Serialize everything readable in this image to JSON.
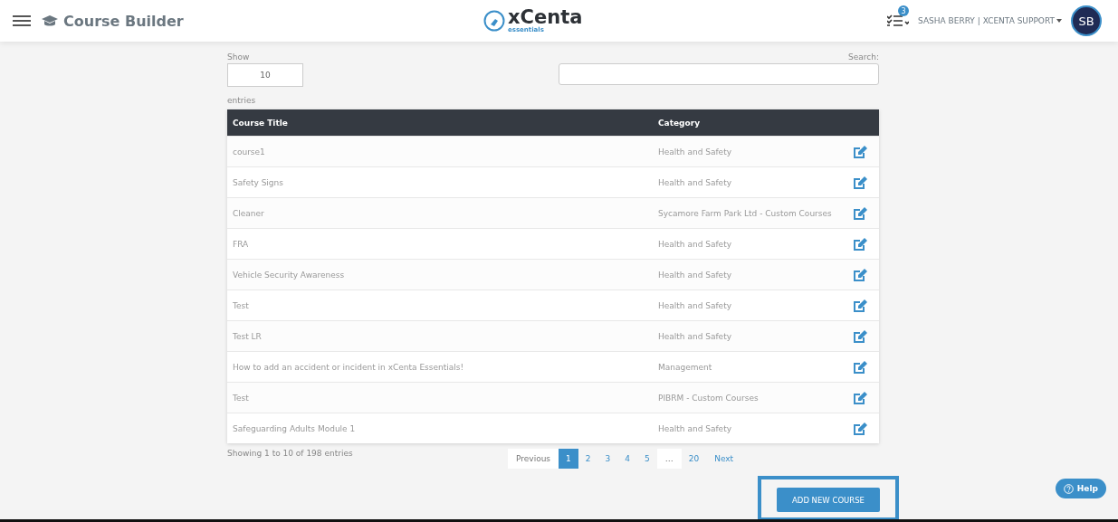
{
  "header": {
    "title": "Course Builder",
    "logo": {
      "name": "xCenta",
      "tagline": "essentials"
    },
    "tasks_badge": "3",
    "user": "SASHA BERRY | XCENTA SUPPORT",
    "avatar": "SB"
  },
  "length": {
    "label": "Show",
    "value": "10",
    "suffix": "entries"
  },
  "search": {
    "label": "Search:"
  },
  "table": {
    "columns": [
      "Course Title",
      "Category"
    ],
    "rows": [
      {
        "title": "course1",
        "category": "Health and Safety"
      },
      {
        "title": "Safety Signs",
        "category": "Health and Safety"
      },
      {
        "title": "Cleaner",
        "category": "Sycamore Farm Park Ltd - Custom Courses"
      },
      {
        "title": "FRA",
        "category": "Health and Safety"
      },
      {
        "title": "Vehicle Security Awareness",
        "category": "Health and Safety"
      },
      {
        "title": "Test",
        "category": "Health and Safety"
      },
      {
        "title": "Test LR",
        "category": "Health and Safety"
      },
      {
        "title": "How to add an accident or incident in xCenta Essentials!",
        "category": "Management"
      },
      {
        "title": "Test",
        "category": "PIBRM - Custom Courses"
      },
      {
        "title": "Safeguarding Adults Module 1",
        "category": "Health and Safety"
      }
    ]
  },
  "info": "Showing 1 to 10 of 198 entries",
  "pagination": [
    {
      "label": "Previous",
      "kind": "nav",
      "selected": false
    },
    {
      "label": "1",
      "kind": "page",
      "selected": true
    },
    {
      "label": "2",
      "kind": "page",
      "selected": false
    },
    {
      "label": "3",
      "kind": "page",
      "selected": false
    },
    {
      "label": "4",
      "kind": "page",
      "selected": false
    },
    {
      "label": "5",
      "kind": "page",
      "selected": false
    },
    {
      "label": "…",
      "kind": "ellipsis",
      "selected": false
    },
    {
      "label": "20",
      "kind": "page",
      "selected": false
    },
    {
      "label": "Next",
      "kind": "nav",
      "selected": false
    }
  ],
  "add_button": "ADD NEW COURSE",
  "help_button": "Help"
}
